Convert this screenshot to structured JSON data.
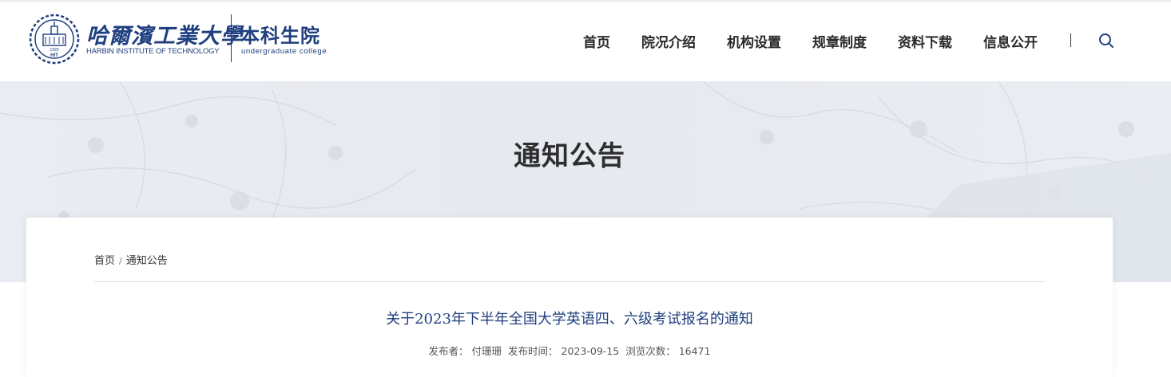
{
  "header": {
    "university_cn": "哈爾濱工業大學",
    "university_en": "HARBIN INSTITUTE OF TECHNOLOGY",
    "college_cn": "本科生院",
    "college_en": "undergraduate  college",
    "emblem_year": "1920",
    "emblem_letters": "HIT"
  },
  "nav": {
    "items": [
      {
        "label": "首页"
      },
      {
        "label": "院况介绍"
      },
      {
        "label": "机构设置"
      },
      {
        "label": "规章制度"
      },
      {
        "label": "资料下载"
      },
      {
        "label": "信息公开"
      }
    ],
    "separator": "|",
    "search_icon": "search-icon"
  },
  "banner": {
    "title": "通知公告"
  },
  "breadcrumb": {
    "items": [
      {
        "label": "首页"
      },
      {
        "label": "通知公告"
      }
    ],
    "separator": "/"
  },
  "article": {
    "title": "关于2023年下半年全国大学英语四、六级考试报名的通知",
    "publisher_label": "发布者：",
    "publisher": "付珊珊",
    "time_label": "发布时间：",
    "time": "2023-09-15",
    "views_label": "浏览次数：",
    "views": "16471"
  },
  "colors": {
    "brand_blue": "#1f3f7f",
    "banner_bg": "#e8ebf1",
    "text_dark": "#2a2a2a"
  }
}
